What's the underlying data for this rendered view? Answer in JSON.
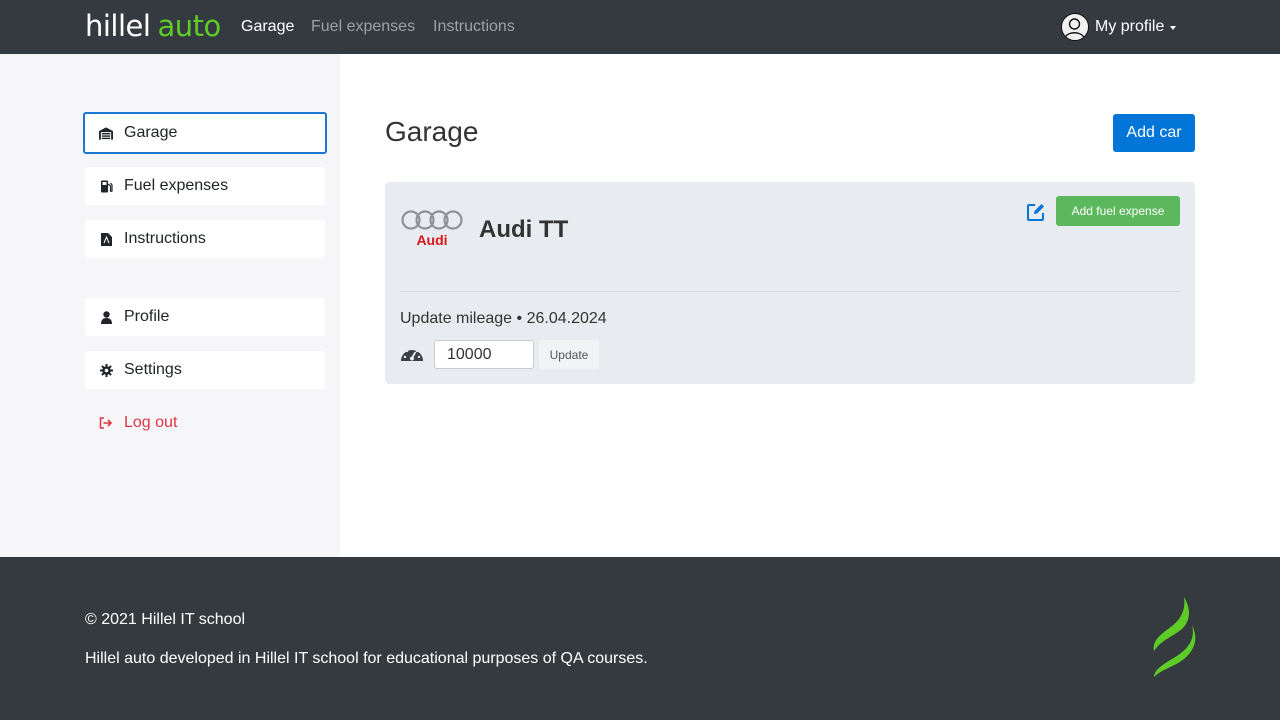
{
  "header": {
    "logo_main": "hillel",
    "logo_accent": "auto",
    "nav": [
      {
        "label": "Garage",
        "active": true
      },
      {
        "label": "Fuel expenses",
        "active": false
      },
      {
        "label": "Instructions",
        "active": false
      }
    ],
    "profile_label": "My profile"
  },
  "sidebar": {
    "items": [
      {
        "label": "Garage",
        "icon": "garage-icon",
        "active": true
      },
      {
        "label": "Fuel expenses",
        "icon": "fuel-pump-icon"
      },
      {
        "label": "Instructions",
        "icon": "pdf-file-icon"
      },
      {
        "label": "Profile",
        "icon": "user-icon"
      },
      {
        "label": "Settings",
        "icon": "gear-icon"
      },
      {
        "label": "Log out",
        "icon": "sign-out-icon"
      }
    ]
  },
  "main": {
    "title": "Garage",
    "add_car_label": "Add car",
    "car": {
      "name": "Audi TT",
      "brand_logo_text": "Audi",
      "add_fuel_label": "Add fuel expense",
      "mileage_label": "Update mileage",
      "mileage_date": "26.04.2024",
      "mileage_value": "10000",
      "update_label": "Update"
    }
  },
  "footer": {
    "copyright": "© 2021 Hillel IT school",
    "description": "Hillel auto developed in Hillel IT school for educational purposes of QA courses."
  },
  "colors": {
    "header_bg": "#343a40",
    "accent_green": "#5ecb27",
    "primary": "#0275d8",
    "success": "#5cb85c",
    "danger": "#dc3545",
    "card_bg": "#e8ebef",
    "sidebar_bg": "#f6f6f8",
    "footer_bg": "#353a3e"
  }
}
